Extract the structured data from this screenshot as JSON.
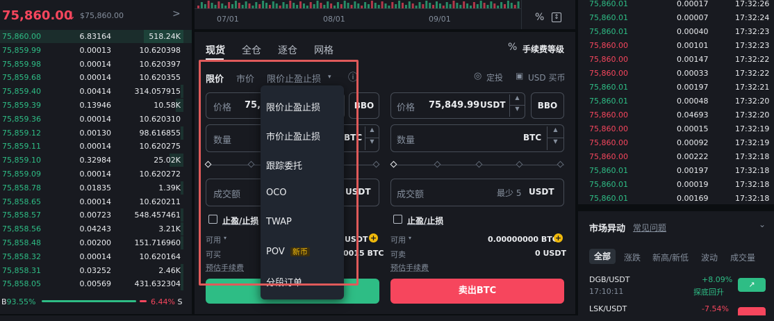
{
  "header": {
    "price": "75,860.00",
    "arrow": "↓",
    "usd": "$75,860.00",
    "chevron": ">"
  },
  "orderbook": [
    {
      "p": "75,860.00",
      "q": "6.83164",
      "t": "518.24K"
    },
    {
      "p": "75,859.99",
      "q": "0.00013",
      "t": "10.620398"
    },
    {
      "p": "75,859.98",
      "q": "0.00014",
      "t": "10.620397"
    },
    {
      "p": "75,859.68",
      "q": "0.00014",
      "t": "10.620355"
    },
    {
      "p": "75,859.40",
      "q": "0.00414",
      "t": "314.057915"
    },
    {
      "p": "75,859.39",
      "q": "0.13946",
      "t": "10.58K"
    },
    {
      "p": "75,859.36",
      "q": "0.00014",
      "t": "10.620310"
    },
    {
      "p": "75,859.12",
      "q": "0.00130",
      "t": "98.616855"
    },
    {
      "p": "75,859.11",
      "q": "0.00014",
      "t": "10.620275"
    },
    {
      "p": "75,859.10",
      "q": "0.32984",
      "t": "25.02K"
    },
    {
      "p": "75,859.09",
      "q": "0.00014",
      "t": "10.620272"
    },
    {
      "p": "75,858.78",
      "q": "0.01835",
      "t": "1.39K"
    },
    {
      "p": "75,858.65",
      "q": "0.00014",
      "t": "10.620211"
    },
    {
      "p": "75,858.57",
      "q": "0.00723",
      "t": "548.457461"
    },
    {
      "p": "75,858.56",
      "q": "0.04243",
      "t": "3.21K"
    },
    {
      "p": "75,858.48",
      "q": "0.00200",
      "t": "151.716960"
    },
    {
      "p": "75,858.32",
      "q": "0.00014",
      "t": "10.620164"
    },
    {
      "p": "75,858.31",
      "q": "0.03252",
      "t": "2.46K"
    },
    {
      "p": "75,858.05",
      "q": "0.00569",
      "t": "431.632304"
    }
  ],
  "ratio": {
    "b": "B",
    "b_pct": "93.55%",
    "s_pct": "6.44%",
    "s": "S",
    "b_frac": 0.9355
  },
  "chart": {
    "dates": [
      "07/01",
      "08/01",
      "09/01"
    ],
    "percent_icon": "%"
  },
  "tabs": [
    "现货",
    "全仓",
    "逐仓",
    "网格"
  ],
  "fee_level": "手续费等级",
  "order_types": {
    "limit": "限价",
    "market": "市价",
    "stop": "限价止盈止损",
    "info": "ⓘ"
  },
  "topright": {
    "dingtou": "定投",
    "usd_buy": "USD 买币"
  },
  "buy": {
    "price_label": "价格",
    "price_value": "75,8",
    "bbo": "BBO",
    "qty_label": "数量",
    "qty_unit": "BTC",
    "total_label": "成交额",
    "total_unit": "USDT",
    "tpsl": "止盈/止损",
    "avail_label": "可用",
    "avail_value": "USDT",
    "canbuy_label": "可买",
    "canbuy_value": "0015 BTC",
    "fee_label": "预估手续费"
  },
  "sell": {
    "price_label": "价格",
    "price_value": "75,849.99",
    "price_unit": "USDT",
    "bbo": "BBO",
    "qty_label": "数量",
    "qty_unit": "BTC",
    "total_label": "成交额",
    "total_min": "最少 5",
    "total_unit": "USDT",
    "tpsl": "止盈/止损",
    "avail_label": "可用",
    "avail_value": "0.00000000 BTC",
    "cansell_label": "可卖",
    "cansell_value": "0 USDT",
    "fee_label": "预估手续费",
    "button": "卖出BTC"
  },
  "dropdown": [
    "限价止盈止损",
    "市价止盈止损",
    "跟踪委托",
    "OCO",
    "TWAP",
    "POV",
    "分段订单"
  ],
  "dropdown_badge": "新币",
  "trades": [
    {
      "p": "75,860.01",
      "q": "0.00017",
      "t": "17:32:26",
      "c": "g"
    },
    {
      "p": "75,860.01",
      "q": "0.00007",
      "t": "17:32:24",
      "c": "g"
    },
    {
      "p": "75,860.01",
      "q": "0.00040",
      "t": "17:32:23",
      "c": "g"
    },
    {
      "p": "75,860.00",
      "q": "0.00101",
      "t": "17:32:23",
      "c": "r"
    },
    {
      "p": "75,860.00",
      "q": "0.00147",
      "t": "17:32:22",
      "c": "r"
    },
    {
      "p": "75,860.00",
      "q": "0.00033",
      "t": "17:32:22",
      "c": "r"
    },
    {
      "p": "75,860.01",
      "q": "0.00197",
      "t": "17:32:21",
      "c": "g"
    },
    {
      "p": "75,860.01",
      "q": "0.00048",
      "t": "17:32:20",
      "c": "g"
    },
    {
      "p": "75,860.00",
      "q": "0.04693",
      "t": "17:32:20",
      "c": "r"
    },
    {
      "p": "75,860.00",
      "q": "0.00015",
      "t": "17:32:19",
      "c": "r"
    },
    {
      "p": "75,860.00",
      "q": "0.00092",
      "t": "17:32:19",
      "c": "r"
    },
    {
      "p": "75,860.00",
      "q": "0.00222",
      "t": "17:32:18",
      "c": "r"
    },
    {
      "p": "75,860.01",
      "q": "0.00197",
      "t": "17:32:18",
      "c": "g"
    },
    {
      "p": "75,860.01",
      "q": "0.00019",
      "t": "17:32:18",
      "c": "g"
    },
    {
      "p": "75,860.01",
      "q": "0.00169",
      "t": "17:32:18",
      "c": "g"
    }
  ],
  "movers": {
    "title": "市场异动",
    "faq": "常见问题",
    "tabs": [
      "全部",
      "涨跌",
      "新高/新低",
      "波动",
      "成交量"
    ],
    "items": [
      {
        "sym": "DGB/USDT",
        "time": "17:10:11",
        "chg": "+8.09%",
        "desc": "探底回升"
      },
      {
        "sym": "LSK/USDT",
        "time": "",
        "chg": "-7.54%",
        "desc": ""
      }
    ]
  },
  "colors": {
    "green": "#2ebd85",
    "red": "#f6465d",
    "highlight": "#f6465d"
  }
}
